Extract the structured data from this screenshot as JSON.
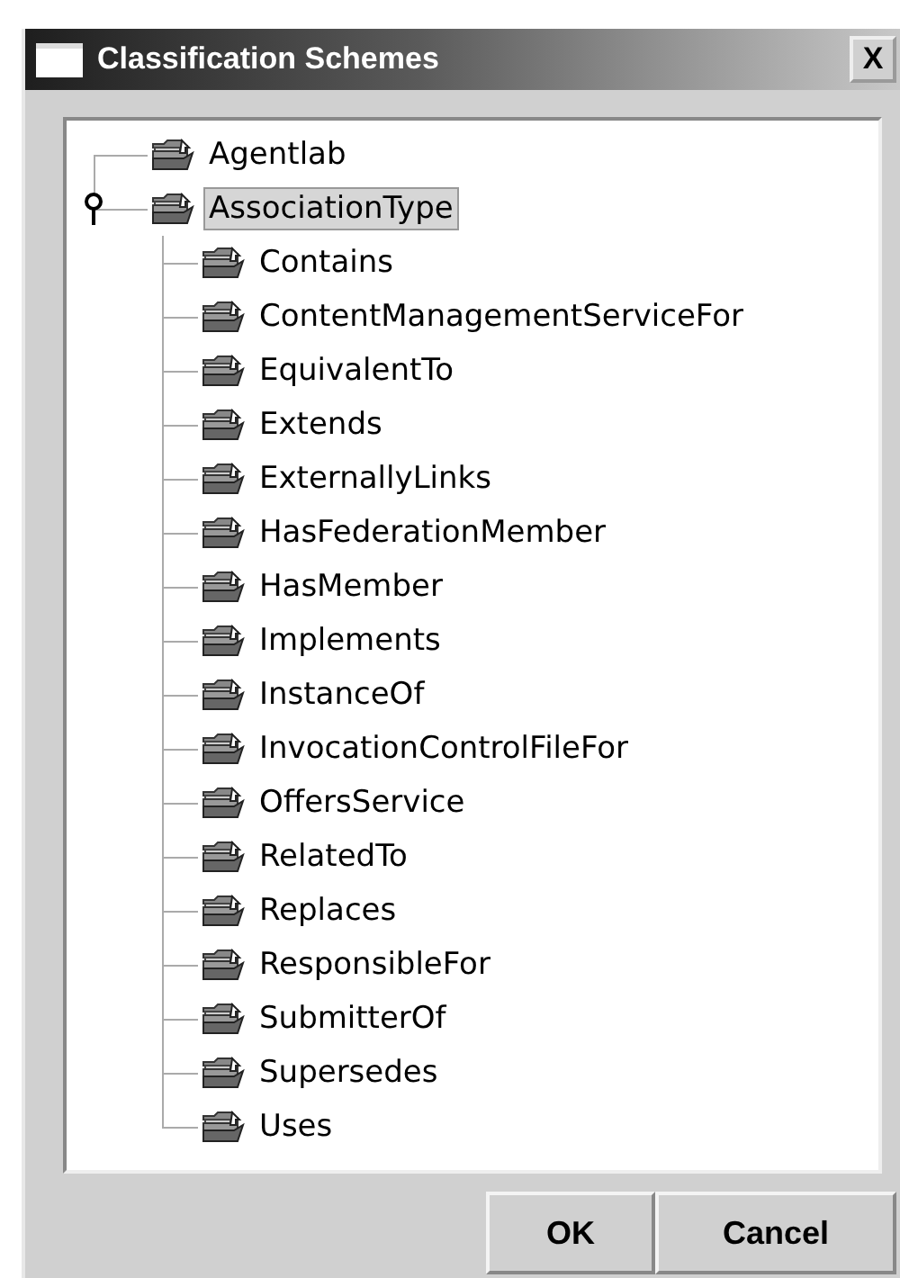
{
  "window": {
    "title": "Classification Schemes",
    "close_label": "X"
  },
  "tree": {
    "nodes": [
      {
        "label": "Agentlab",
        "selected": false
      },
      {
        "label": "AssociationType",
        "selected": true,
        "expanded": true,
        "children": [
          {
            "label": "Contains",
            "selected": false
          },
          {
            "label": "ContentManagementServiceFor",
            "selected": false
          },
          {
            "label": "EquivalentTo",
            "selected": false
          },
          {
            "label": "Extends",
            "selected": false
          },
          {
            "label": "ExternallyLinks",
            "selected": false
          },
          {
            "label": "HasFederationMember",
            "selected": false
          },
          {
            "label": "HasMember",
            "selected": false
          },
          {
            "label": "Implements",
            "selected": false
          },
          {
            "label": "InstanceOf",
            "selected": false
          },
          {
            "label": "InvocationControlFileFor",
            "selected": false
          },
          {
            "label": "OffersService",
            "selected": false
          },
          {
            "label": "RelatedTo",
            "selected": false
          },
          {
            "label": "Replaces",
            "selected": false
          },
          {
            "label": "ResponsibleFor",
            "selected": false
          },
          {
            "label": "SubmitterOf",
            "selected": false
          },
          {
            "label": "Supersedes",
            "selected": false
          },
          {
            "label": "Uses",
            "selected": false
          }
        ]
      }
    ]
  },
  "buttons": [
    "OK",
    "Cancel"
  ]
}
